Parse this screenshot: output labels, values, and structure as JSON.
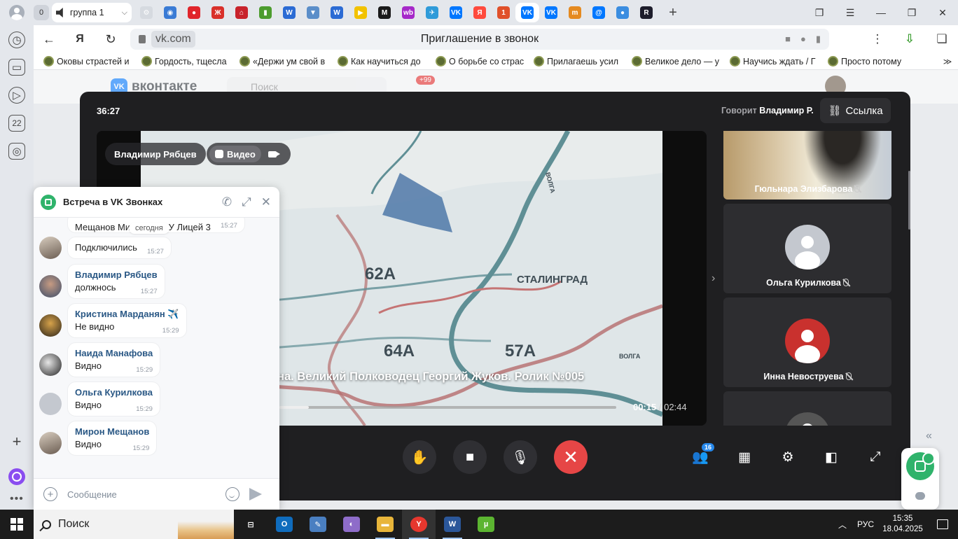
{
  "browser": {
    "tab_count": "0",
    "active_tab_title": "группа 1",
    "address_domain": "vk.com",
    "page_title": "Приглашение в звонок",
    "pinned_tabs": [
      {
        "name": "settings-tab",
        "color": "#d6dae0",
        "glyph": "⚙"
      },
      {
        "name": "maps-tab",
        "color": "#3a7bd5",
        "glyph": "◉"
      },
      {
        "name": "red-circle-tab",
        "color": "#e0252b",
        "glyph": "●"
      },
      {
        "name": "red-grid-tab",
        "color": "#d9302a",
        "glyph": "Ж"
      },
      {
        "name": "home-tab",
        "color": "#c8232b",
        "glyph": "⌂"
      },
      {
        "name": "green-tab",
        "color": "#4c9c2e",
        "glyph": "▮"
      },
      {
        "name": "blue-w-tab",
        "color": "#2b6bd4",
        "glyph": "W"
      },
      {
        "name": "shield-tab",
        "color": "#5b8ec9",
        "glyph": "▼"
      },
      {
        "name": "blue-w2-tab",
        "color": "#2b6bd4",
        "glyph": "W"
      },
      {
        "name": "yellow-play-tab",
        "color": "#f2c200",
        "glyph": "▶"
      },
      {
        "name": "m-tab",
        "color": "#1a1a1a",
        "glyph": "M"
      },
      {
        "name": "wb-tab",
        "color": "#a629c9",
        "glyph": "wb"
      },
      {
        "name": "plane-tab",
        "color": "#2f9bd9",
        "glyph": "✈"
      },
      {
        "name": "vk-tab-1",
        "color": "#0077ff",
        "glyph": "VK"
      },
      {
        "name": "yandex-tab",
        "color": "#ff4a3d",
        "glyph": "Я"
      },
      {
        "name": "news-tab",
        "color": "#e0502a",
        "glyph": "1"
      },
      {
        "name": "vk-tab-2",
        "color": "#0077ff",
        "glyph": "VK"
      },
      {
        "name": "vk-tab-3",
        "color": "#0077ff",
        "glyph": "VK"
      },
      {
        "name": "fm-tab",
        "color": "#e58a20",
        "glyph": "m"
      },
      {
        "name": "mail-tab",
        "color": "#0077ff",
        "glyph": "@"
      },
      {
        "name": "bubble-tab",
        "color": "#3b8de0",
        "glyph": "●"
      },
      {
        "name": "r-tab",
        "color": "#1d1d2b",
        "glyph": "R"
      }
    ],
    "bookmarks": [
      "Оковы страстей и",
      "Гордость, тщесла",
      "«Держи ум свой в",
      "Как научиться до",
      "О борьбе со страс",
      "Прилагаешь усил",
      "Великое дело — у",
      "Научись ждать / Г",
      "Просто потому"
    ]
  },
  "vk": {
    "logo_text": "вконтакте",
    "search_placeholder": "Поиск",
    "notifications_badge": "+99"
  },
  "call": {
    "timer": "36:27",
    "speaking_label": "Говорит",
    "speaking_name": "Владимир Р.",
    "link_button": "Ссылка",
    "presenter_name": "Владимир Рябцев",
    "video_label": "Видео",
    "video_title": "на. Великий Полководец Георгий Жуков. Ролик №005",
    "video_current": "00:15",
    "video_separator": " / ",
    "video_total": "02:44",
    "video_progress_fraction": 0.09,
    "map_labels": {
      "army_62": "62А",
      "stalingrad": "СТАЛИНГРАД",
      "army_64": "64А",
      "army_57": "57А",
      "volga_1": "ВОЛГА",
      "volga_2": "ВОЛГА"
    },
    "participants": [
      {
        "name": "Гюльнара Элизбарова",
        "muted": true,
        "has_video": true
      },
      {
        "name": "Ольга Курилкова",
        "muted": true,
        "has_video": false
      },
      {
        "name": "Инна Невоструева",
        "muted": true,
        "has_video": false
      }
    ],
    "participants_count": "16",
    "colors": {
      "end_call": "#e64646",
      "badge": "#2688eb",
      "panel": "#1f1f21"
    }
  },
  "chat": {
    "title": "Встреча в VK Звонках",
    "day_separator": "сегодня",
    "input_placeholder": "Сообщение",
    "messages": [
      {
        "author": "",
        "text": "Мещанов Мирон МОБУ Лицей 3",
        "time": "15:27"
      },
      {
        "author": "",
        "text": "Подключились",
        "time": "15:27"
      },
      {
        "author": "Владимир Рябцев",
        "text": "должнось",
        "time": "15:27"
      },
      {
        "author": "Кристина Марданян ✈️",
        "text": "Не видно",
        "time": "15:29"
      },
      {
        "author": "Наида Манафова",
        "text": "Видно",
        "time": "15:29"
      },
      {
        "author": "Ольга Курилкова",
        "text": "Видно",
        "time": "15:29"
      },
      {
        "author": "Мирон Мещанов",
        "text": "Видно",
        "time": "15:29"
      }
    ]
  },
  "taskbar": {
    "search_label": "Поиск",
    "language": "РУС",
    "time": "15:35",
    "date": "18.04.2025",
    "apps": [
      {
        "name": "task-view",
        "color": "#1c1c1c",
        "glyph": "⊟",
        "running": false
      },
      {
        "name": "outlook",
        "color": "#0f6cbd",
        "glyph": "O",
        "running": false
      },
      {
        "name": "paint-app",
        "color": "#4a7fc1",
        "glyph": "✎",
        "running": false
      },
      {
        "name": "paint3d",
        "color": "#8e6cc9",
        "glyph": "◐",
        "running": false
      },
      {
        "name": "file-explorer",
        "color": "#e8b53a",
        "glyph": "▬",
        "running": true
      },
      {
        "name": "yandex-browser",
        "color": "#e6372e",
        "glyph": "Y",
        "running": true
      },
      {
        "name": "word",
        "color": "#2b579a",
        "glyph": "W",
        "running": true
      },
      {
        "name": "utorrent",
        "color": "#5cb531",
        "glyph": "µ",
        "running": false
      }
    ]
  }
}
